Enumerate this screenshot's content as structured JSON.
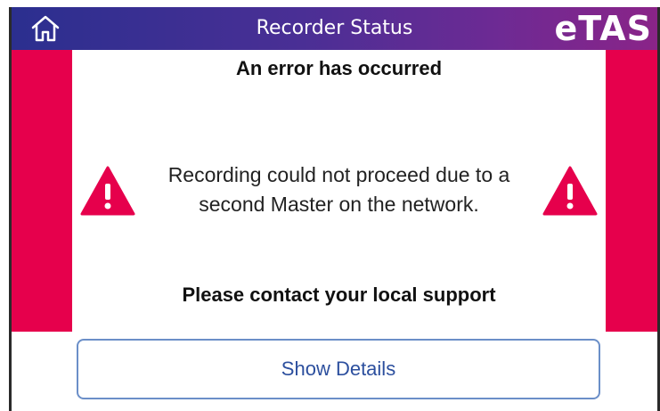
{
  "header": {
    "title": "Recorder Status",
    "logo_text": "eTAS",
    "home_icon": "home-icon",
    "gradient_colors": [
      "#2b2f8f",
      "#8a2488"
    ]
  },
  "main": {
    "heading": "An error has occurred",
    "message_line1": "Recording could not proceed due to a",
    "message_line2": "second Master on the network.",
    "support_text": "Please contact your local support",
    "warning_icon": "warning-icon",
    "accent_color": "#e6004c"
  },
  "footer": {
    "details_button_label": "Show Details",
    "details_button_color": "#2c4f9e"
  }
}
